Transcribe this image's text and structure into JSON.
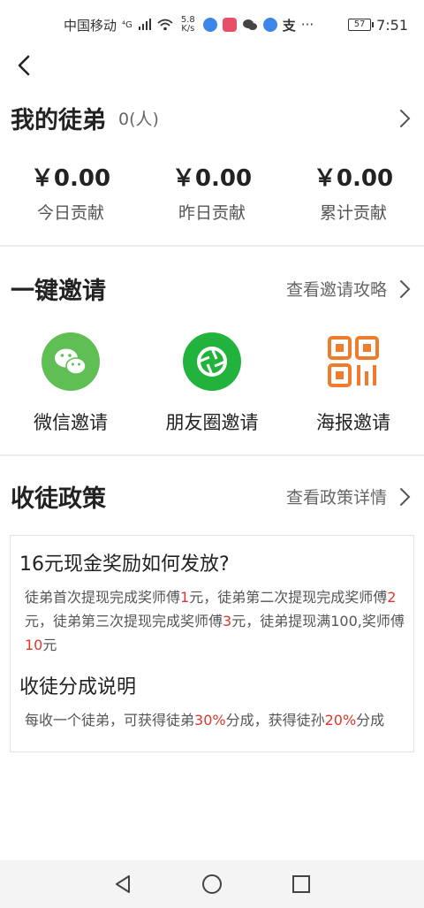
{
  "status": {
    "carrier": "中国移动",
    "network": "⁴G",
    "speed_top": "5.8",
    "speed_bottom": "K/s",
    "more": "···",
    "battery": "57",
    "time": "7:51"
  },
  "apprentices": {
    "title": "我的徒弟",
    "count": "0(人)",
    "stats": [
      {
        "value": "￥0.00",
        "label": "今日贡献"
      },
      {
        "value": "￥0.00",
        "label": "昨日贡献"
      },
      {
        "value": "￥0.00",
        "label": "累计贡献"
      }
    ]
  },
  "invite": {
    "title": "一键邀请",
    "link": "查看邀请攻略",
    "options": [
      {
        "label": "微信邀请",
        "icon": "wechat-icon",
        "color": "#5fbe54"
      },
      {
        "label": "朋友圈邀请",
        "icon": "moments-icon",
        "color": "#22b33d"
      },
      {
        "label": "海报邀请",
        "icon": "qrcode-icon",
        "color": "#ef7b2c"
      }
    ]
  },
  "policy": {
    "title": "收徒政策",
    "link": "查看政策详情",
    "q1": "16元现金奖励如何发放?",
    "p1": {
      "a": "徒弟首次提现完成奖师傅",
      "v1": "1",
      "b": "元，徒弟第二次提现完成奖师傅",
      "v2": "2",
      "c": "元，徒弟第三次提现完成奖师傅",
      "v3": "3",
      "d": "元，徒弟提现满100,奖师傅",
      "v4": "10",
      "e": "元"
    },
    "q2": "收徒分成说明",
    "p2": {
      "a": "每收一个徒弟，可获得徒弟",
      "v1": "30%",
      "b": "分成，获得徒孙",
      "v2": "20%",
      "c": "分成"
    }
  }
}
